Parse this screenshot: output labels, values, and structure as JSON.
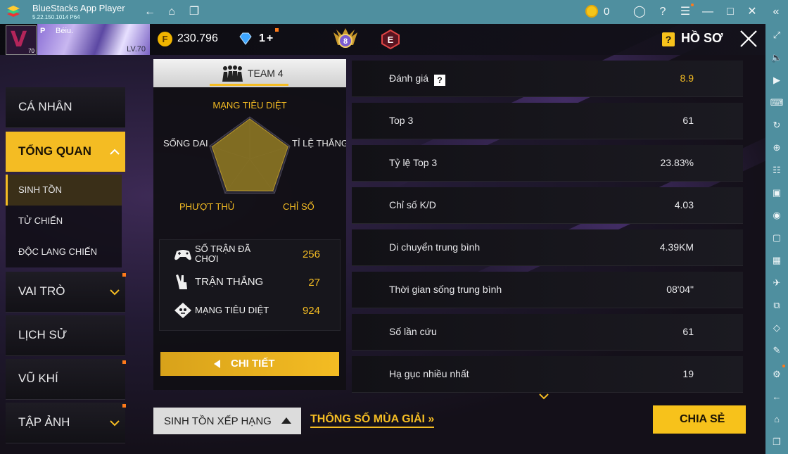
{
  "window": {
    "title": "BlueStacks App Player",
    "version": "5.22.150.1014  P64",
    "coin_count": "0"
  },
  "header": {
    "player_rank_letter": "V",
    "avatar_level": "70",
    "banner_prefix": "P",
    "player_name": "Béiu.",
    "banner_level": "LV.70",
    "gold_symbol": "F",
    "gold": "230.796",
    "diamonds": "1",
    "diamond_plus": "+",
    "rank_badge_number": "8",
    "rank_badge_letter": "E",
    "help_symbol": "?",
    "page_title": "HỒ SƠ"
  },
  "nav": {
    "items": [
      {
        "label": "CÁ NHÂN"
      },
      {
        "label": "TỔNG QUAN"
      },
      {
        "label": "VAI TRÒ"
      },
      {
        "label": "LỊCH SỬ"
      },
      {
        "label": "VŨ KHÍ"
      },
      {
        "label": "TẬP ẢNH"
      }
    ],
    "sub_items": [
      {
        "label": "SINH TỒN"
      },
      {
        "label": "TỬ CHIẾN"
      },
      {
        "label": "ĐỘC LANG CHIẾN"
      }
    ]
  },
  "card": {
    "team_label": "TEAM 4",
    "radar_labels": {
      "top": "MẠNG TIÊU DIỆT",
      "left": "SỐNG DAI",
      "right": "TỈ LỆ THẮNG",
      "bottom_left": "PHƯỢT THỦ",
      "bottom_right": "CHỈ SỐ"
    },
    "radar_values": [
      0.95,
      0.95,
      0.93,
      0.92,
      0.94
    ],
    "stats": [
      {
        "label_line1": "SỐ TRẬN ĐÃ",
        "label_line2": "CHƠI",
        "value": "256",
        "icon": "gamepad-icon"
      },
      {
        "label_line1": "TRẬN THẮNG",
        "label_line2": "",
        "value": "27",
        "icon": "victory-hand-icon"
      },
      {
        "label_line1": "MẠNG TIÊU DIỆT",
        "label_line2": "",
        "value": "924",
        "icon": "skull-icon"
      }
    ],
    "detail_button": "CHI TIẾT"
  },
  "rows": [
    {
      "label": "Đánh giá",
      "value": "8.9",
      "has_help": true,
      "help_symbol": "?"
    },
    {
      "label": "Top 3",
      "value": "61"
    },
    {
      "label": "Tỷ lệ Top 3",
      "value": "23.83%"
    },
    {
      "label": "Chỉ số K/D",
      "value": "4.03"
    },
    {
      "label": "Di chuyển trung bình",
      "value": "4.39KM"
    },
    {
      "label": "Thời gian sống trung bình",
      "value": "08'04\""
    },
    {
      "label": "Số lần cứu",
      "value": "61"
    },
    {
      "label": "Hạ gục nhiều nhất",
      "value": "19"
    }
  ],
  "bottom": {
    "mode_select": "SINH TỒN XẾP HẠNG",
    "season_link": "THÔNG SỐ MÙA GIẢI »",
    "share_button": "CHIA SẺ"
  },
  "colors": {
    "accent": "#f4bc23",
    "bluestacks_bar": "#4f8f9f",
    "rating_value": "#f4bc23",
    "notification_dot": "#ff7a1a"
  }
}
